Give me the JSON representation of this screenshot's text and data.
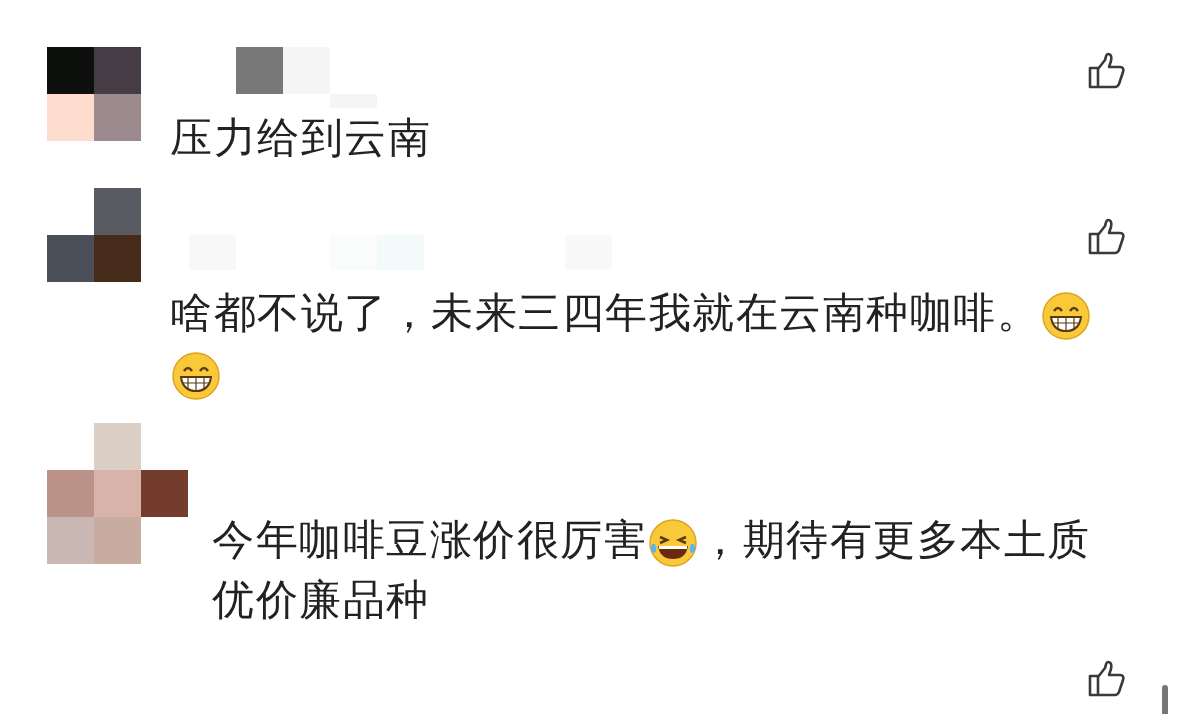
{
  "comments": [
    {
      "parts": [
        {
          "kind": "text",
          "text": "压力给到云南"
        }
      ]
    },
    {
      "parts": [
        {
          "kind": "text",
          "text": "啥都不说了，未来三四年我就在云南种咖啡。"
        },
        {
          "kind": "grin"
        },
        {
          "kind": "grin"
        }
      ]
    },
    {
      "parts": [
        {
          "kind": "text",
          "text": "今年咖啡豆涨价很厉害"
        },
        {
          "kind": "tears"
        },
        {
          "kind": "text",
          "text": "，期待有更多本土质"
        },
        {
          "kind": "text",
          "text": "优价廉品种"
        }
      ]
    }
  ]
}
